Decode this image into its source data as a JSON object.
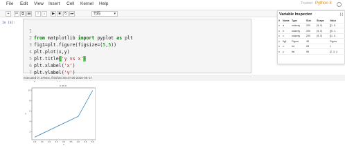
{
  "menubar": {
    "items": [
      "File",
      "Edit",
      "View",
      "Insert",
      "Cell",
      "Kernel",
      "Help"
    ],
    "trusted_label": "Trusted",
    "kernel_label": "Python 3"
  },
  "toolbar": {
    "buttons": [
      "+",
      "✂",
      "⧉",
      "▤",
      "↑",
      "↓",
      "▶",
      "■",
      "↻",
      "⏭"
    ],
    "cell_type": "代码"
  },
  "cell": {
    "prompt": "In [3]:",
    "lines": [
      "from matplotlib import pyplot as plt",
      "fig1=plt.figure(figsize=(5,5))",
      "plt.plot(x,y)",
      "plt.title('y vs x')",
      "plt.xlabel('x')",
      "plt.ylabel('y')",
      "plt.show()"
    ],
    "line_numbers": [
      "1",
      "2",
      "3",
      "4",
      "5",
      "6",
      "7"
    ],
    "exec_info": "executed in 179ms, finished 00:47:09 2020-06-17"
  },
  "chart_data": {
    "type": "line",
    "title": "y vs x",
    "xlabel": "x",
    "ylabel": "y",
    "x": [
      1.0,
      4.0,
      5.0
    ],
    "y": [
      1,
      5,
      10
    ],
    "xlim": [
      0.8,
      5.2
    ],
    "ylim": [
      0.5,
      10.5
    ],
    "xticks": [
      "1.0",
      "1.5",
      "2.0",
      "2.5",
      "3.0",
      "3.5",
      "4.0",
      "4.5",
      "5.0"
    ],
    "yticks": [
      "2",
      "4",
      "6",
      "8",
      "10"
    ],
    "line_color": "#1f77b4"
  },
  "variable_inspector": {
    "title": "Variable Inspector",
    "collapse": "[-]",
    "columns": [
      "X",
      "Name",
      "Type",
      "Size",
      "Shape",
      "Value"
    ],
    "rows": [
      [
        "x",
        "a",
        "ndarray",
        "200",
        "(5, 5)",
        "[[1. 0."
      ],
      [
        "x",
        "b",
        "ndarray",
        "200",
        "(5, 5)",
        "[[0. 1."
      ],
      [
        "x",
        "c",
        "ndarray",
        "200",
        "(5, 5)",
        "[[1. 0."
      ],
      [
        "x",
        "fig1",
        "Figure",
        "48",
        "",
        "Figure"
      ],
      [
        "x",
        "x",
        "int",
        "28",
        "",
        "1"
      ],
      [
        "x",
        "y",
        "list",
        "96",
        "",
        "[2, 3, 4"
      ]
    ]
  }
}
